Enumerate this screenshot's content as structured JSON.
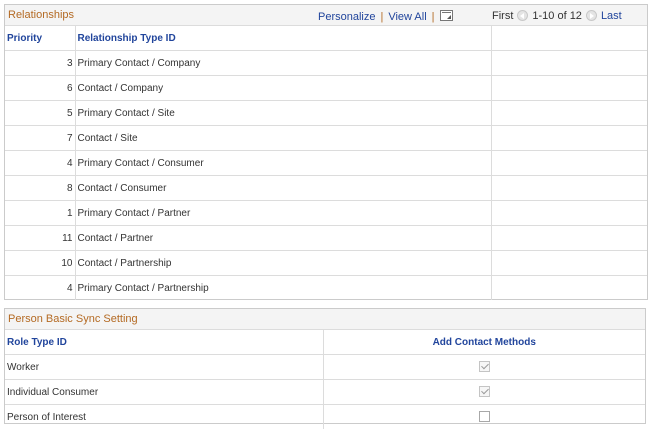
{
  "relationships": {
    "title": "Relationships",
    "nav": {
      "personalize": "Personalize",
      "separator": "|",
      "view_all": "View All",
      "first": "First",
      "range": "1-10 of 12",
      "last": "Last"
    },
    "columns": {
      "priority": "Priority",
      "relationship_type": "Relationship Type ID",
      "extra": ""
    },
    "rows": [
      {
        "priority": "3",
        "type": "Primary Contact / Company"
      },
      {
        "priority": "6",
        "type": "Contact / Company"
      },
      {
        "priority": "5",
        "type": "Primary Contact / Site"
      },
      {
        "priority": "7",
        "type": "Contact / Site"
      },
      {
        "priority": "4",
        "type": "Primary Contact / Consumer"
      },
      {
        "priority": "8",
        "type": "Contact / Consumer"
      },
      {
        "priority": "1",
        "type": "Primary Contact / Partner"
      },
      {
        "priority": "11",
        "type": "Contact / Partner"
      },
      {
        "priority": "10",
        "type": "Contact / Partnership"
      },
      {
        "priority": "4",
        "type": "Primary Contact / Partnership"
      }
    ]
  },
  "person_sync": {
    "title": "Person Basic Sync Setting",
    "columns": {
      "role_type": "Role Type ID",
      "add_contact": "Add Contact Methods"
    },
    "rows": [
      {
        "role": "Worker",
        "checked": true,
        "disabled": true
      },
      {
        "role": "Individual Consumer",
        "checked": true,
        "disabled": true
      },
      {
        "role": "Person of Interest",
        "checked": false,
        "disabled": false
      }
    ]
  },
  "colors": {
    "title": "#b46a23",
    "link": "#21459c",
    "header_bg": "#f4f4f4"
  },
  "icons": [
    "zoom-icon",
    "prev-arrow-icon",
    "next-arrow-icon"
  ]
}
